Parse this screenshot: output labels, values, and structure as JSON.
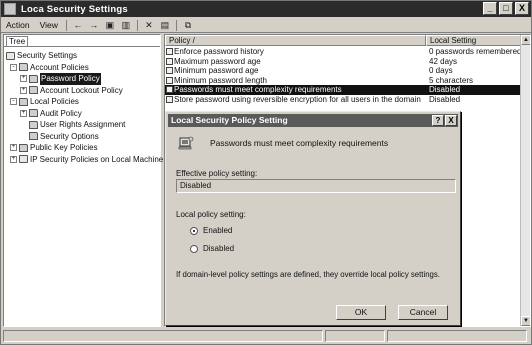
{
  "window": {
    "title": "Loca Security Settings",
    "controls": [
      "_",
      "□",
      "X"
    ]
  },
  "menubar": {
    "items": [
      {
        "label": "Action"
      },
      {
        "label": "View"
      }
    ],
    "toolbar_icons": [
      "back-arrow-icon",
      "forward-arrow-icon",
      "up-icon",
      "show-tree-icon",
      "delete-icon",
      "properties-icon",
      "export-icon"
    ]
  },
  "tree": {
    "tab_label": "Tree",
    "items": [
      {
        "label": "Security Settings",
        "depth": 0,
        "expander": ""
      },
      {
        "label": "Account Policies",
        "depth": 1,
        "expander": "-"
      },
      {
        "label": "Password Policy",
        "depth": 2,
        "expander": "+",
        "selected": true
      },
      {
        "label": "Account Lockout Policy",
        "depth": 2,
        "expander": "+"
      },
      {
        "label": "Local Policies",
        "depth": 1,
        "expander": "-"
      },
      {
        "label": "Audit Policy",
        "depth": 2,
        "expander": "+"
      },
      {
        "label": "User Rights Assignment",
        "depth": 2,
        "expander": ""
      },
      {
        "label": "Security Options",
        "depth": 2,
        "expander": ""
      },
      {
        "label": "Public Key Policies",
        "depth": 1,
        "expander": "+"
      },
      {
        "label": "IP Security Policies on Local Machine",
        "depth": 1,
        "expander": "+"
      }
    ]
  },
  "list": {
    "columns": {
      "policy": "Policy  /",
      "setting": "Local Setting"
    },
    "rows": [
      {
        "policy": "Enforce password history",
        "setting": "0 passwords remembered"
      },
      {
        "policy": "Maximum password age",
        "setting": "42 days"
      },
      {
        "policy": "Minimum password age",
        "setting": "0 days"
      },
      {
        "policy": "Minimum password length",
        "setting": "5 characters"
      },
      {
        "policy": "Passwords must meet complexity requirements",
        "setting": "Disabled",
        "selected": true
      },
      {
        "policy": "Store password using reversible encryption for all users in the domain",
        "setting": "Disabled"
      }
    ]
  },
  "dialog": {
    "title": "Local Security Policy Setting",
    "help": "?",
    "close": "X",
    "heading": "Passwords must meet complexity requirements",
    "effective_label": "Effective policy setting:",
    "effective_value": "Disabled",
    "local_label": "Local policy setting:",
    "radio_enabled": "Enabled",
    "radio_disabled": "Disabled",
    "selected_option": "Enabled",
    "note": "If domain-level policy settings are defined, they override local policy settings.",
    "ok_label": "OK",
    "cancel_label": "Cancel"
  }
}
